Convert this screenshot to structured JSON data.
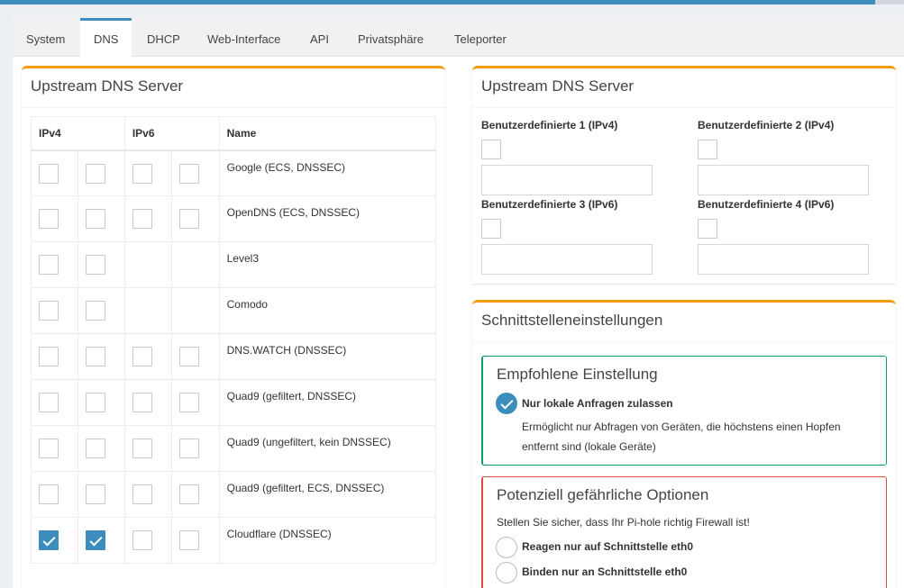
{
  "tabs": [
    {
      "label": "System"
    },
    {
      "label": "DNS"
    },
    {
      "label": "DHCP"
    },
    {
      "label": "Web-Interface"
    },
    {
      "label": "API"
    },
    {
      "label": "Privatsphäre"
    },
    {
      "label": "Teleporter"
    }
  ],
  "upstream_table": {
    "title": "Upstream DNS Server",
    "headers": {
      "ipv4": "IPv4",
      "ipv6": "IPv6",
      "name": "Name"
    },
    "rows": [
      {
        "name": "Google (ECS, DNSSEC)",
        "v4": [
          false,
          false
        ],
        "v6": [
          false,
          false
        ],
        "has_v6": true
      },
      {
        "name": "OpenDNS (ECS, DNSSEC)",
        "v4": [
          false,
          false
        ],
        "v6": [
          false,
          false
        ],
        "has_v6": true
      },
      {
        "name": "Level3",
        "v4": [
          false,
          false
        ],
        "v6": [],
        "has_v6": false
      },
      {
        "name": "Comodo",
        "v4": [
          false,
          false
        ],
        "v6": [],
        "has_v6": false
      },
      {
        "name": "DNS.WATCH (DNSSEC)",
        "v4": [
          false,
          false
        ],
        "v6": [
          false,
          false
        ],
        "has_v6": true
      },
      {
        "name": "Quad9 (gefiltert, DNSSEC)",
        "v4": [
          false,
          false
        ],
        "v6": [
          false,
          false
        ],
        "has_v6": true
      },
      {
        "name": "Quad9 (ungefiltert, kein DNSSEC)",
        "v4": [
          false,
          false
        ],
        "v6": [
          false,
          false
        ],
        "has_v6": true
      },
      {
        "name": "Quad9 (gefiltert, ECS, DNSSEC)",
        "v4": [
          false,
          false
        ],
        "v6": [
          false,
          false
        ],
        "has_v6": true
      },
      {
        "name": "Cloudflare (DNSSEC)",
        "v4": [
          true,
          true
        ],
        "v6": [
          false,
          false
        ],
        "has_v6": true
      }
    ]
  },
  "custom": {
    "title": "Upstream DNS Server",
    "fields": [
      {
        "label": "Benutzerdefinierte 1 (IPv4)",
        "value": "",
        "checked": false
      },
      {
        "label": "Benutzerdefinierte 2 (IPv4)",
        "value": "",
        "checked": false
      },
      {
        "label": "Benutzerdefinierte 3 (IPv6)",
        "value": "",
        "checked": false
      },
      {
        "label": "Benutzerdefinierte 4 (IPv6)",
        "value": "",
        "checked": false
      }
    ]
  },
  "interface": {
    "title": "Schnittstelleneinstellungen",
    "recommended": {
      "title": "Empfohlene Einstellung",
      "option_label": "Nur lokale Anfragen zulassen",
      "option_desc_1": "Ermöglicht nur Abfragen von Geräten, die höchstens einen Hopfen",
      "option_desc_2": "entfernt sind (lokale Geräte)"
    },
    "dangerous": {
      "title": "Potenziell gefährliche Optionen",
      "note": "Stellen Sie sicher, dass Ihr Pi-hole richtig Firewall ist!",
      "options": [
        {
          "label": "Reagen nur auf Schnittstelle eth0"
        },
        {
          "label": "Binden nur an Schnittstelle eth0"
        }
      ]
    }
  },
  "colors": {
    "accent": "#3c8dbc",
    "box_border": "#f39c12",
    "green": "#00a65a",
    "red": "#dd4b39"
  }
}
